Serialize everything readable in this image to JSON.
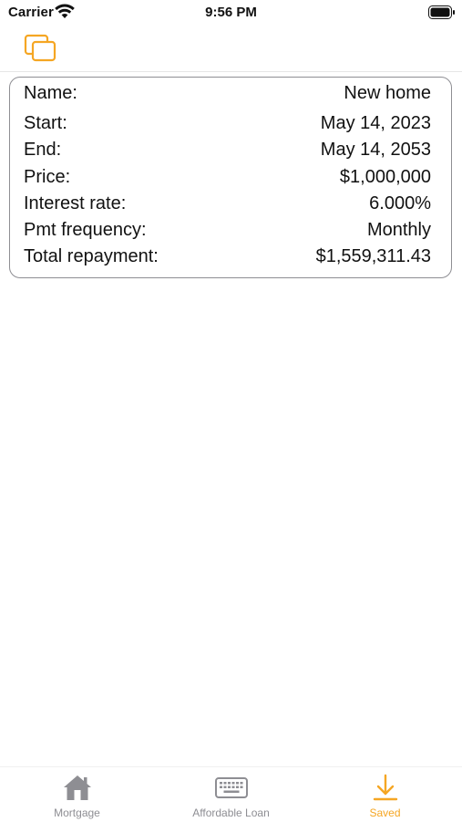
{
  "status_bar": {
    "carrier": "Carrier",
    "time": "9:56 PM"
  },
  "nav": {
    "icon": "copy-icon"
  },
  "loan": {
    "rows": [
      {
        "label": "Name:",
        "value": "New home"
      },
      {
        "label": "Start:",
        "value": "May 14, 2023"
      },
      {
        "label": "End:",
        "value": "May 14, 2053"
      },
      {
        "label": "Price:",
        "value": "$1,000,000"
      },
      {
        "label": "Interest rate:",
        "value": "6.000%"
      },
      {
        "label": "Pmt frequency:",
        "value": "Monthly"
      },
      {
        "label": "Total repayment:",
        "value": "$1,559,311.43"
      }
    ]
  },
  "tabs": [
    {
      "label": "Mortgage",
      "icon": "house-icon",
      "active": false
    },
    {
      "label": "Affordable Loan",
      "icon": "keyboard-icon",
      "active": false
    },
    {
      "label": "Saved",
      "icon": "download-icon",
      "active": true
    }
  ],
  "colors": {
    "accent": "#f5a623",
    "inactive": "#8e8e93",
    "border": "#8e8e93"
  }
}
